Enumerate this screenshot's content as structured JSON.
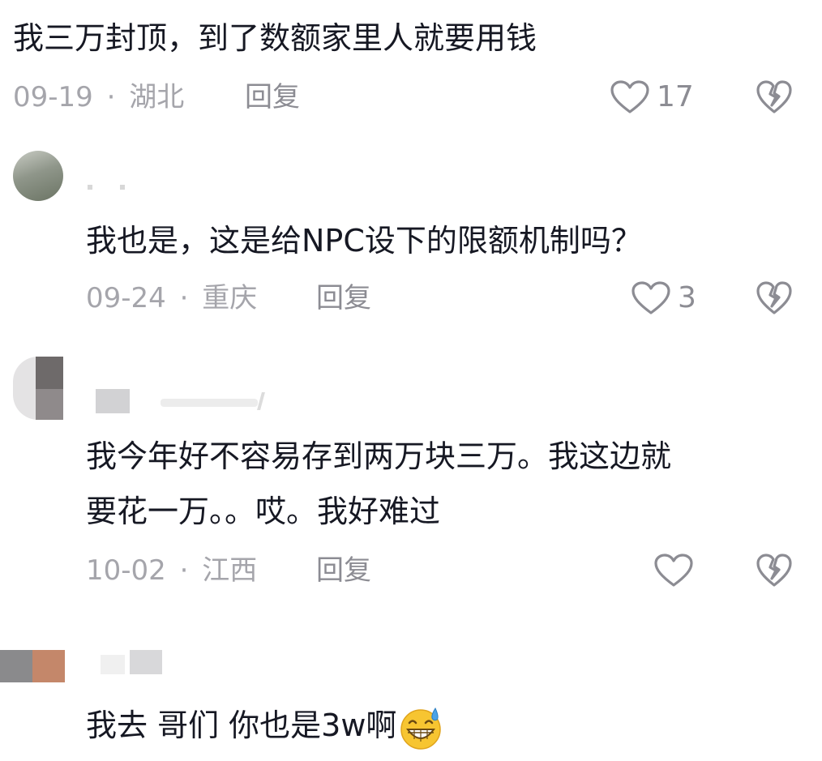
{
  "comments": [
    {
      "text": "我三万封顶，到了数额家里人就要用钱",
      "date": "09-19",
      "separator": "·",
      "location": "湖北",
      "reply_label": "回复",
      "likes": "17"
    },
    {
      "text": "我也是，这是给NPC设下的限额机制吗？",
      "date": "09-24",
      "separator": "·",
      "location": "重庆",
      "reply_label": "回复",
      "likes": "3"
    },
    {
      "text_line1": "我今年好不容易存到两万块三万。我这边就",
      "text_line2": "要花一万。。哎。我好难过",
      "date": "10-02",
      "separator": "·",
      "location": "江西",
      "reply_label": "回复",
      "likes": ""
    },
    {
      "text": "我去 哥们 你也是3w啊",
      "emoji": "grinning-sweat-emoji"
    }
  ],
  "colors": {
    "text": "#161823",
    "meta": "#a5a5ab",
    "icon": "#8c8c93"
  }
}
